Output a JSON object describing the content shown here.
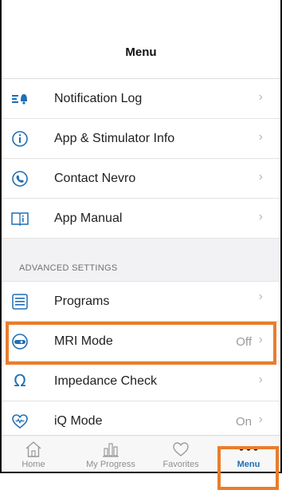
{
  "header": {
    "title": "Menu"
  },
  "menu": {
    "items": [
      {
        "label": "Notification Log",
        "value": "",
        "icon": "notification-log-icon"
      },
      {
        "label": "App & Stimulator Info",
        "value": "",
        "icon": "info-icon"
      },
      {
        "label": "Contact Nevro",
        "value": "",
        "icon": "phone-icon"
      },
      {
        "label": "App Manual",
        "value": "",
        "icon": "book-icon"
      }
    ],
    "section_header": "ADVANCED SETTINGS",
    "advanced_items": [
      {
        "label": "Programs",
        "value": "",
        "icon": "programs-list-icon"
      },
      {
        "label": "MRI Mode",
        "value": "Off",
        "icon": "mri-icon"
      },
      {
        "label": "Impedance Check",
        "value": "",
        "icon": "omega-icon"
      },
      {
        "label": "iQ Mode",
        "value": "On",
        "icon": "heart-wave-icon"
      }
    ],
    "chevron": "›"
  },
  "tabbar": {
    "tabs": [
      {
        "label": "Home",
        "icon": "home-icon"
      },
      {
        "label": "My Progress",
        "icon": "bar-chart-icon"
      },
      {
        "label": "Favorites",
        "icon": "heart-icon"
      },
      {
        "label": "Menu",
        "icon": "more-dots-icon",
        "active": true
      }
    ]
  },
  "colors": {
    "accent": "#1f6fb5",
    "highlight": "#e97d2c",
    "inactive_tab": "#8e8e93"
  }
}
